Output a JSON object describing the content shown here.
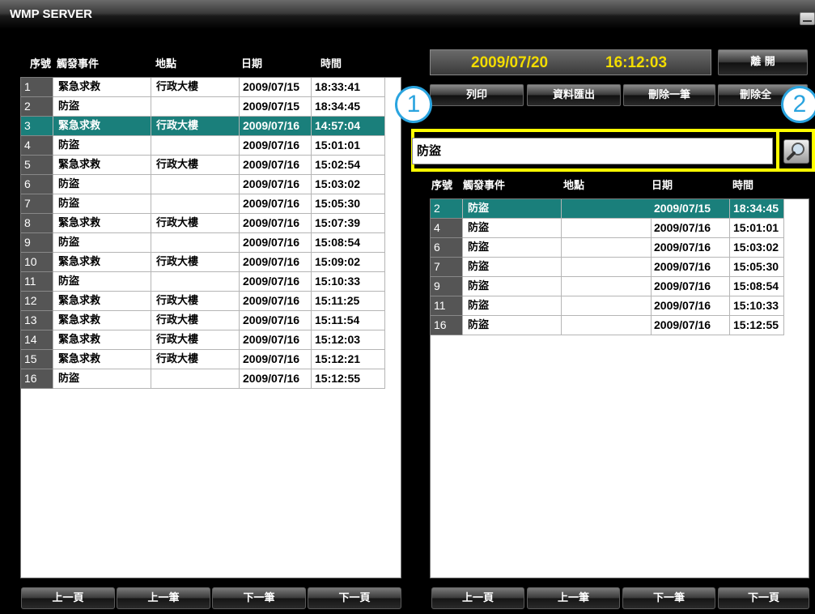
{
  "window": {
    "title": "WMP SERVER"
  },
  "left": {
    "headers": {
      "num": "序號",
      "event": "觸發事件",
      "place": "地點",
      "date": "日期",
      "time": "時間"
    },
    "rows": [
      {
        "num": "1",
        "event": "緊急求救",
        "place": "行政大樓",
        "date": "2009/07/15",
        "time": "18:33:41"
      },
      {
        "num": "2",
        "event": "防盜",
        "place": "",
        "date": "2009/07/15",
        "time": "18:34:45"
      },
      {
        "num": "3",
        "event": "緊急求救",
        "place": "行政大樓",
        "date": "2009/07/16",
        "time": "14:57:04"
      },
      {
        "num": "4",
        "event": "防盜",
        "place": "",
        "date": "2009/07/16",
        "time": "15:01:01"
      },
      {
        "num": "5",
        "event": "緊急求救",
        "place": "行政大樓",
        "date": "2009/07/16",
        "time": "15:02:54"
      },
      {
        "num": "6",
        "event": "防盜",
        "place": "",
        "date": "2009/07/16",
        "time": "15:03:02"
      },
      {
        "num": "7",
        "event": "防盜",
        "place": "",
        "date": "2009/07/16",
        "time": "15:05:30"
      },
      {
        "num": "8",
        "event": "緊急求救",
        "place": "行政大樓",
        "date": "2009/07/16",
        "time": "15:07:39"
      },
      {
        "num": "9",
        "event": "防盜",
        "place": "",
        "date": "2009/07/16",
        "time": "15:08:54"
      },
      {
        "num": "10",
        "event": "緊急求救",
        "place": "行政大樓",
        "date": "2009/07/16",
        "time": "15:09:02"
      },
      {
        "num": "11",
        "event": "防盜",
        "place": "",
        "date": "2009/07/16",
        "time": "15:10:33"
      },
      {
        "num": "12",
        "event": "緊急求救",
        "place": "行政大樓",
        "date": "2009/07/16",
        "time": "15:11:25"
      },
      {
        "num": "13",
        "event": "緊急求救",
        "place": "行政大樓",
        "date": "2009/07/16",
        "time": "15:11:54"
      },
      {
        "num": "14",
        "event": "緊急求救",
        "place": "行政大樓",
        "date": "2009/07/16",
        "time": "15:12:03"
      },
      {
        "num": "15",
        "event": "緊急求救",
        "place": "行政大樓",
        "date": "2009/07/16",
        "time": "15:12:21"
      },
      {
        "num": "16",
        "event": "防盜",
        "place": "",
        "date": "2009/07/16",
        "time": "15:12:55"
      }
    ],
    "selected_row": 3,
    "nav": {
      "first_page": "上一頁",
      "prev_record": "上一筆",
      "next_record": "下一筆",
      "next_page": "下一頁"
    }
  },
  "right": {
    "datetime": {
      "date": "2009/07/20",
      "time": "16:12:03"
    },
    "leave_label": "離 開",
    "actions": {
      "print": "列印",
      "export": "資料匯出",
      "delete_one": "刪除一筆",
      "delete_all": "刪除全"
    },
    "search": {
      "value": "防盜"
    },
    "headers": {
      "num": "序號",
      "event": "觸發事件",
      "place": "地點",
      "date": "日期",
      "time": "時間"
    },
    "rows": [
      {
        "num": "2",
        "event": "防盜",
        "place": "",
        "date": "2009/07/15",
        "time": "18:34:45"
      },
      {
        "num": "4",
        "event": "防盜",
        "place": "",
        "date": "2009/07/16",
        "time": "15:01:01"
      },
      {
        "num": "6",
        "event": "防盜",
        "place": "",
        "date": "2009/07/16",
        "time": "15:03:02"
      },
      {
        "num": "7",
        "event": "防盜",
        "place": "",
        "date": "2009/07/16",
        "time": "15:05:30"
      },
      {
        "num": "9",
        "event": "防盜",
        "place": "",
        "date": "2009/07/16",
        "time": "15:08:54"
      },
      {
        "num": "11",
        "event": "防盜",
        "place": "",
        "date": "2009/07/16",
        "time": "15:10:33"
      },
      {
        "num": "16",
        "event": "防盜",
        "place": "",
        "date": "2009/07/16",
        "time": "15:12:55"
      }
    ],
    "selected_row": 2,
    "nav": {
      "first_page": "上一頁",
      "prev_record": "上一筆",
      "next_record": "下一筆",
      "next_page": "下一頁"
    }
  },
  "callouts": {
    "one": "1",
    "two": "2"
  },
  "colors": {
    "accent": "#ffff00",
    "selected": "#1a7f7b",
    "datetime_text": "#f2dc00",
    "callout": "#2aa4df"
  }
}
